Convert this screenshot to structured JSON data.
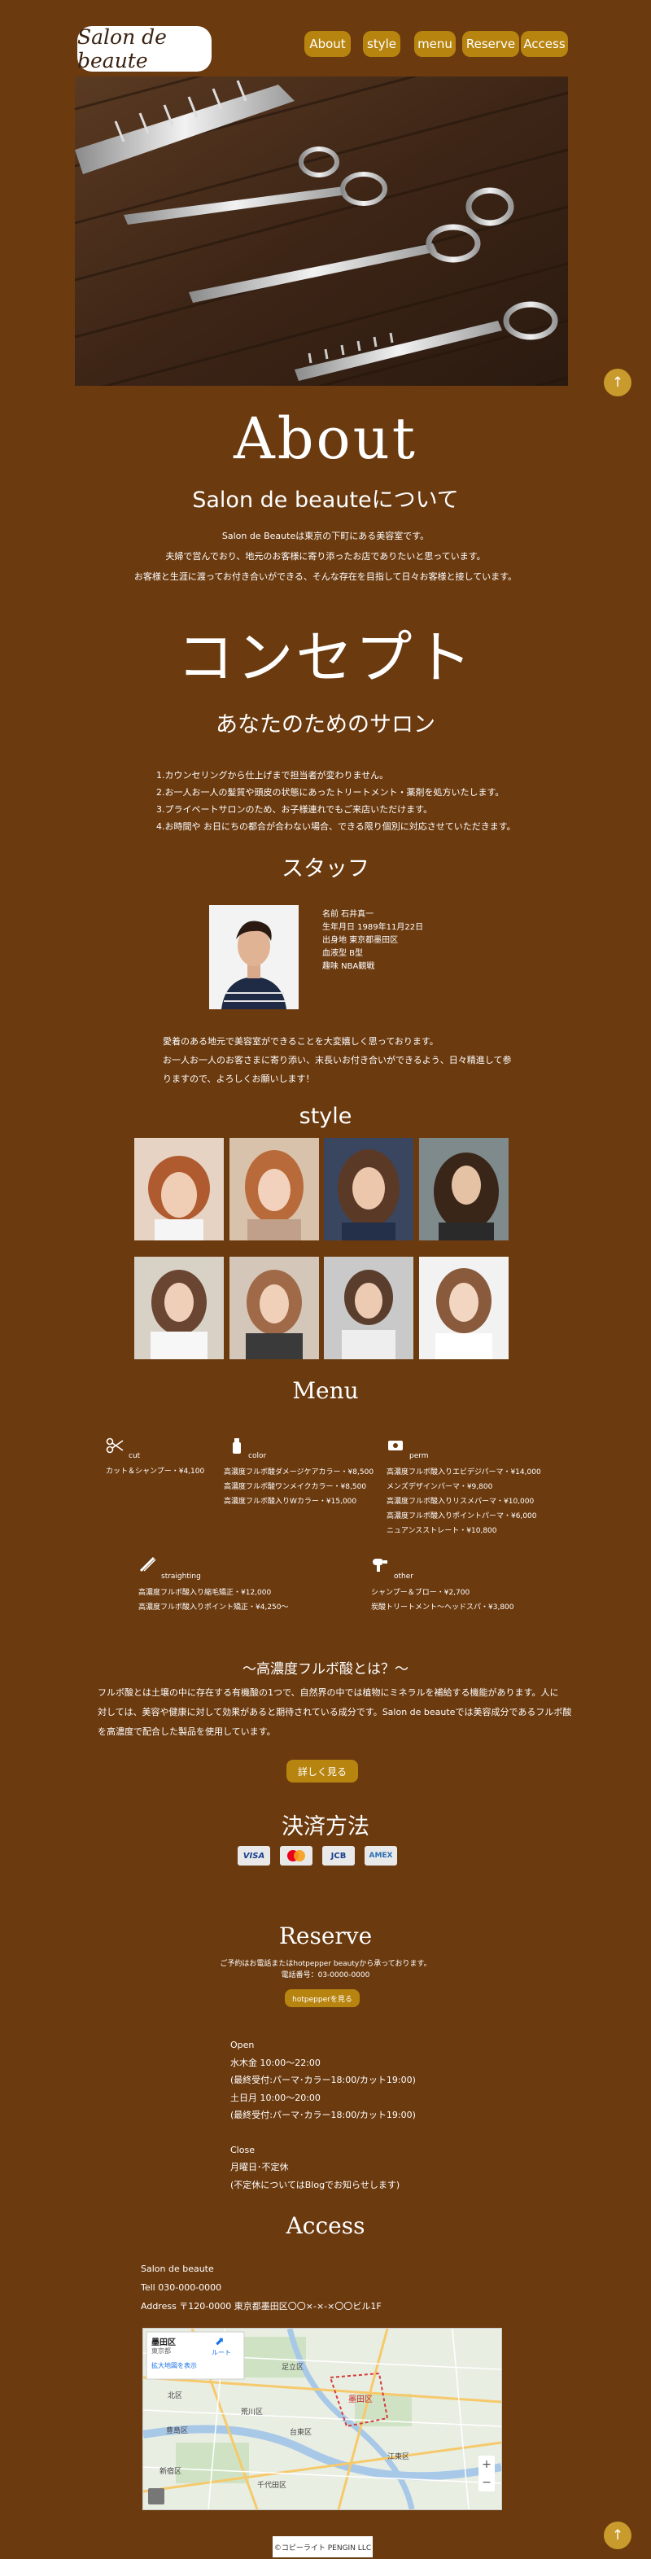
{
  "header": {
    "logo": "Salon de beaute",
    "nav": [
      "About",
      "style",
      "menu",
      "Reserve",
      "Access"
    ]
  },
  "about": {
    "title": "About",
    "subtitle": "Salon de beauteについて",
    "lines": [
      "Salon de Beauteは東京の下町にある美容室です。",
      "夫婦で営んでおり、地元のお客様に寄り添ったお店でありたいと思っています。",
      "お客様と生涯に渡ってお付き合いができる、そんな存在を目指して日々お客様と接しています。"
    ]
  },
  "concept": {
    "title": "コンセプト",
    "subtitle": "あなたのためのサロン",
    "items": [
      "1.カウンセリングから仕上げまで担当者が変わりません。",
      "2.お一人お一人の髪質や頭皮の状態にあったトリートメント・薬剤を処方いたします。",
      "3.プライベートサロンのため、お子様連れでもご来店いただけます。",
      "4.お時間や お日にちの都合が合わない場合、できる限り個別に対応させていただきます。"
    ]
  },
  "staff": {
    "title": "スタッフ",
    "profile": [
      "名前 石井真一",
      "生年月日 1989年11月22日",
      "出身地 東京都墨田区",
      "血液型 B型",
      "趣味 NBA観戦"
    ],
    "message": [
      "愛着のある地元で美容室ができることを大変嬉しく思っております。",
      "お一人お一人のお客さまに寄り添い、末長いお付き合いができるよう、日々精進して参",
      "りますので、よろしくお願いします！"
    ]
  },
  "style": {
    "title": "style"
  },
  "menu": {
    "title": "Menu",
    "groups": [
      {
        "icon": "scissors-icon",
        "name": "cut",
        "items": [
          "カット＆シャンプー・¥4,100"
        ]
      },
      {
        "icon": "hair-dye-icon",
        "name": "color",
        "items": [
          "高濃度フルボ酸ダメージケアカラー・¥8,500",
          "高濃度フルボ酸ワンメイクカラー・¥8,500",
          "高濃度フルボ酸入りWカラー・¥15,000"
        ]
      },
      {
        "icon": "perm-machine-icon",
        "name": "perm",
        "items": [
          "高濃度フルボ酸入りエビデジパーマ・¥14,000",
          "メンズデザインパーマ・¥9,800",
          "高濃度フルボ酸入りリスメパーマ・¥10,000",
          "高濃度フルボ酸入りポイントパーマ・¥6,000",
          "ニュアンスストレート・¥10,800"
        ]
      },
      {
        "icon": "flat-iron-icon",
        "name": "straighting",
        "items": [
          "高濃度フルボ酸入り縮毛矯正・¥12,000",
          "高濃度フルボ酸入りポイント矯正・¥4,250〜"
        ]
      },
      {
        "icon": "hair-dryer-icon",
        "name": "other",
        "items": [
          "シャンプー＆ブロー・¥2,700",
          "炭酸トリートメント〜ヘッドスパ・¥3,800"
        ]
      }
    ],
    "fulvic_title": "〜高濃度フルボ酸とは？〜",
    "fulvic_lines": [
      "フルボ酸とは土壌の中に存在する有機酸の1つで、自然界の中では植物にミネラルを補給する機能があります。人に",
      "対しては、美容や健康に対して効果があると期待されている成分です。Salon de beauteでは美容成分であるフルボ酸",
      "を高濃度で配合した製品を使用しています。"
    ],
    "detail_button": "詳しく見る"
  },
  "payment": {
    "title": "決済方法",
    "cards": [
      {
        "name": "visa-icon",
        "label": "VISA",
        "color": "#e9e9e9",
        "text": "#1a3f8f"
      },
      {
        "name": "mastercard-icon",
        "label": "",
        "color": "#e9e9e9",
        "text": "#333"
      },
      {
        "name": "jcb-icon",
        "label": "JCB",
        "color": "#e9e9e9",
        "text": "#1a3f8f"
      },
      {
        "name": "amex-icon",
        "label": "AMEX",
        "color": "#e9e9e9",
        "text": "#2a6fb5"
      }
    ]
  },
  "reserve": {
    "title": "Reserve",
    "lines": [
      "ご予約はお電話またはhotpepper beautyから承っております。",
      "電話番号：03-0000-0000"
    ],
    "button": "hotpepperを見る",
    "hours": [
      "Open",
      "水木金 10:00〜22:00",
      "(最終受付:パーマ･カラー18:00/カット19:00)",
      "土日月 10:00〜20:00",
      "(最終受付:パーマ･カラー18:00/カット19:00)",
      "",
      "Close",
      "月曜日･不定休",
      "(不定休についてはBlogでお知らせします)"
    ]
  },
  "access": {
    "title": "Access",
    "lines": [
      "Salon de beaute",
      "Tell 030-000-0000",
      "Address 〒120-0000 東京都墨田区〇〇×-×-×〇〇ビル1F"
    ],
    "map": {
      "place": "墨田区",
      "place_sub": "東京都",
      "link": "拡大地図を表示",
      "route": "ルート",
      "labels": [
        "足立区",
        "北区",
        "荒川区",
        "墨田区",
        "新宿区",
        "豊島区",
        "江東区",
        "台東区",
        "千代田区"
      ]
    }
  },
  "footer": {
    "copyright": "©コピーライト PENGIN LLC"
  },
  "scroll": {
    "icon": "arrow-up-icon",
    "glyph": "↑"
  }
}
